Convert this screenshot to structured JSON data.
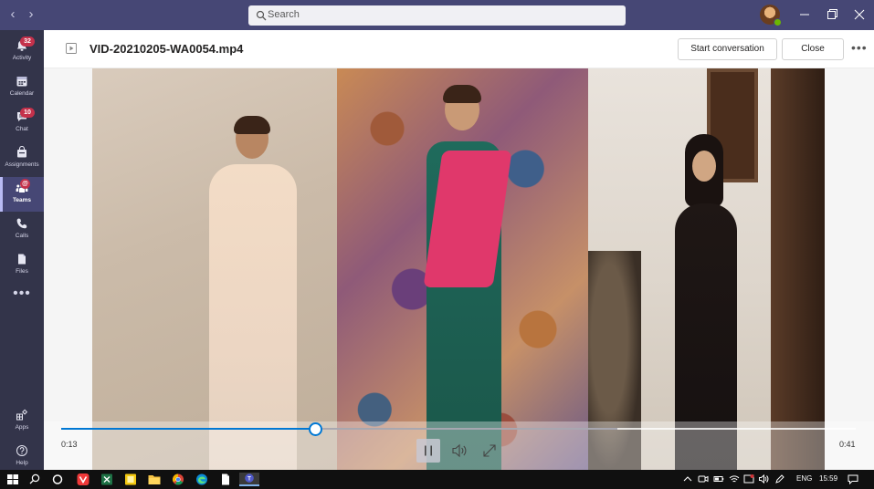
{
  "search": {
    "placeholder": "Search"
  },
  "rail": {
    "items": [
      {
        "label": "Activity",
        "badge": "32"
      },
      {
        "label": "Calendar",
        "badge": ""
      },
      {
        "label": "Chat",
        "badge": "10"
      },
      {
        "label": "Assignments",
        "badge": ""
      },
      {
        "label": "Teams",
        "badge": "@"
      },
      {
        "label": "Calls",
        "badge": ""
      },
      {
        "label": "Files",
        "badge": ""
      },
      {
        "label": "Apps",
        "badge": ""
      },
      {
        "label": "Help",
        "badge": ""
      }
    ],
    "more": "•••"
  },
  "header": {
    "title": "VID-20210205-WA0054.mp4",
    "start_conversation": "Start conversation",
    "close": "Close",
    "more": "•••"
  },
  "player": {
    "current_time": "0:13",
    "duration": "0:41",
    "progress_fraction": 0.32,
    "buffered_fraction": 0.7
  },
  "taskbar": {
    "language": "ENG",
    "clock": "15:59",
    "apps": [
      "start-icon",
      "search-icon",
      "cortana-icon",
      "vivaldi-icon",
      "excel-icon",
      "sticky-notes-icon",
      "file-explorer-icon",
      "chrome-icon",
      "edge-icon",
      "document-icon",
      "teams-icon"
    ]
  },
  "colors": {
    "title_bar": "#464775",
    "rail": "#33344a",
    "accent": "#0078d4",
    "badge": "#c4314b"
  }
}
